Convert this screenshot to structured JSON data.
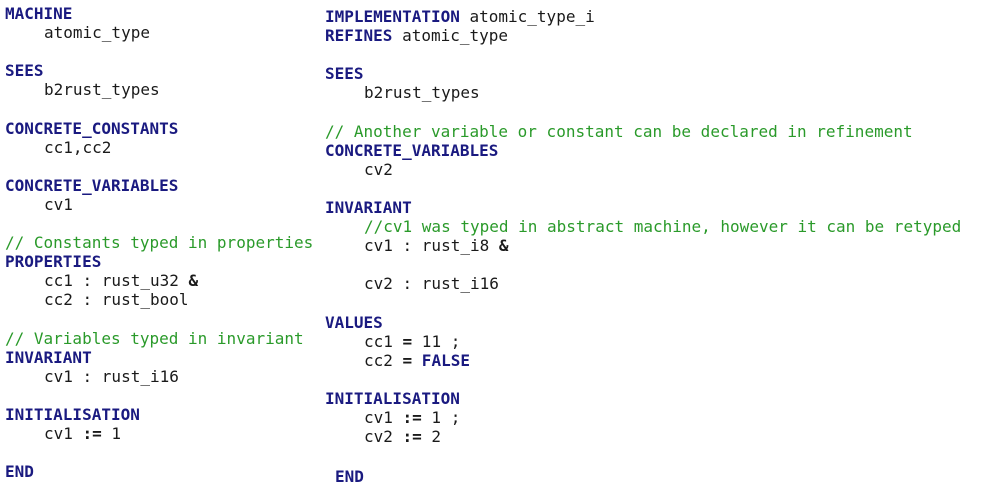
{
  "left": {
    "machine_kw": "MACHINE",
    "machine_name": "atomic_type",
    "sees_kw": "SEES",
    "sees_value": "b2rust_types",
    "cc_kw": "CONCRETE_CONSTANTS",
    "cc_value": "cc1,cc2",
    "cv_kw": "CONCRETE_VARIABLES",
    "cv_value": "cv1",
    "comment_props": "// Constants typed in properties",
    "props_kw": "PROPERTIES",
    "prop1": "cc1 : rust_u32 ",
    "prop1_op": "&",
    "prop2": "cc2 : rust_bool",
    "comment_inv": "// Variables typed in invariant",
    "inv_kw": "INVARIANT",
    "inv1": "cv1 : rust_i16",
    "init_kw": "INITIALISATION",
    "init1_a": "cv1 ",
    "init1_op": ":=",
    "init1_b": " 1",
    "end_kw": "END"
  },
  "right": {
    "impl_kw": "IMPLEMENTATION",
    "impl_name": " atomic_type_i",
    "refines_kw": "REFINES",
    "refines_name": " atomic_type",
    "sees_kw": "SEES",
    "sees_value": "b2rust_types",
    "comment_decl": "// Another variable or constant can be declared in refinement",
    "cv_kw": "CONCRETE_VARIABLES",
    "cv_value": "cv2",
    "inv_kw": "INVARIANT",
    "inv_comment": "//cv1 was typed in abstract machine, however it can be retyped",
    "inv1": "cv1 : rust_i8 ",
    "inv1_op": "&",
    "inv2": "cv2 : rust_i16",
    "values_kw": "VALUES",
    "val1_a": "cc1 ",
    "val1_op": "=",
    "val1_b": " 11 ;",
    "val2_a": "cc2 ",
    "val2_op": "=",
    "val2_b": " FALSE",
    "init_kw": "INITIALISATION",
    "init1_a": "cv1 ",
    "init1_op": ":=",
    "init1_b": " 1 ;",
    "init2_a": "cv2 ",
    "init2_op": ":=",
    "init2_b": " 2",
    "end_kw": "END"
  }
}
